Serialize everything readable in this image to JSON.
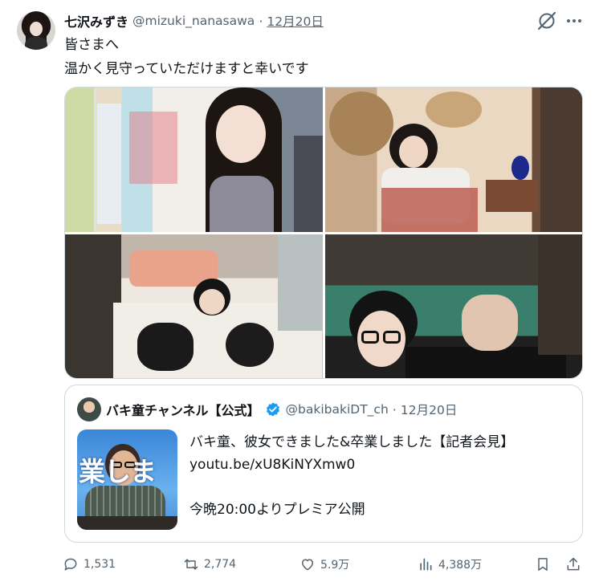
{
  "tweet": {
    "display_name": "七沢みずき",
    "handle": "@mizuki_nanasawa",
    "separator": "·",
    "date": "12月20日",
    "text": "皆さまへ\n温かく見守っていただけますと幸いです"
  },
  "quoted_tweet": {
    "display_name": "バキ童チャンネル【公式】",
    "handle": "@bakibakiDT_ch",
    "separator": "·",
    "date": "12月20日",
    "thumbnail_text": "業しま",
    "text": "バキ童、彼女できました&卒業しました【記者会見】\nyoutu.be/xU8KiNYXmw0\n\n今晩20:00よりプレミア公開"
  },
  "actions": {
    "replies": "1,531",
    "reposts": "2,774",
    "likes": "5.9万",
    "views": "4,388万"
  },
  "icons": {
    "grok": "grok-icon",
    "more": "more-icon",
    "verified": "verified-badge-icon",
    "reply": "reply-icon",
    "repost": "repost-icon",
    "like": "heart-icon",
    "views": "views-chart-icon",
    "bookmark": "bookmark-icon",
    "share": "share-icon"
  },
  "colors": {
    "text": "#0f1419",
    "secondary": "#536471",
    "border": "#cfd9de",
    "verified": "#1d9bf0"
  }
}
